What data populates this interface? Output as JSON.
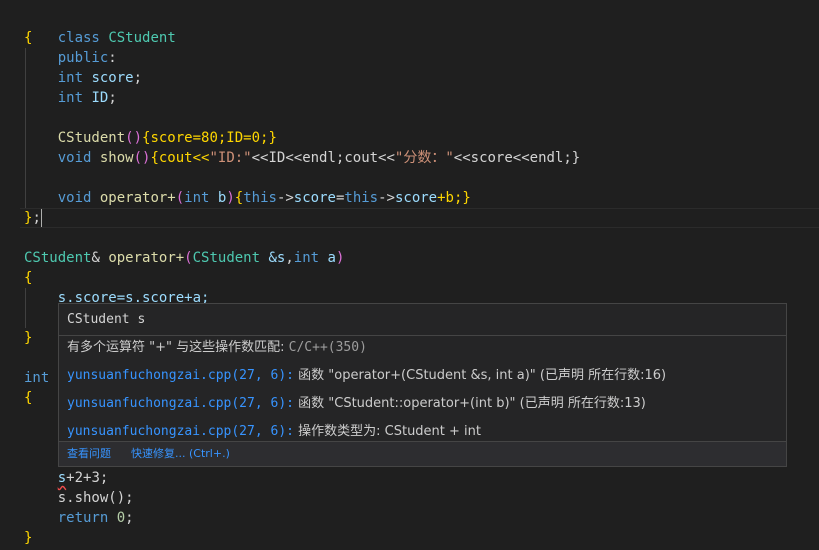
{
  "code": {
    "kw_class": "class",
    "cls_name": "CStudent",
    "lbrace": "{",
    "rbrace": "}",
    "semi": ";",
    "kw_public": "public",
    "colon": ":",
    "kw_int": "int",
    "var_score": "score",
    "var_id": "ID",
    "ctor_body": "{score=80;ID=0;}",
    "kw_void": "void",
    "fn_show": "show",
    "show_body_1": "{cout<<",
    "str_id": "\"ID:\"",
    "show_body_2": "<<ID<<endl;cout<<",
    "str_score": "\"分数：\"",
    "show_body_3": "<<score<<endl;}",
    "fn_operator": "operator+",
    "param_b": "b",
    "kw_this": "this",
    "arrow": "->",
    "member_body_3": "=",
    "member_body_end": "+b;}",
    "ret_type_amp": "&",
    "param_s": "&s",
    "param_a": "a",
    "comma": ",",
    "body_line": "s.score=s.score+a;",
    "stmt_expr_s": "s",
    "stmt_expr_rest": "+2+3;",
    "stmt_show": "s.show();",
    "kw_return": "return",
    "ret_val": "0",
    "lparen": "(",
    "rparen": ")",
    "parens": "()"
  },
  "hover": {
    "title": "CStudent s",
    "message": "有多个运算符 \"+\" 与这些操作数匹配:",
    "message_code": "C/C++(350)",
    "entries": [
      {
        "link": "yunsuanfuchongzai.cpp(27, 6):",
        "text": "函数 \"operator+(CStudent &s, int a)\" (已声明 所在行数:16)"
      },
      {
        "link": "yunsuanfuchongzai.cpp(27, 6):",
        "text": "函数 \"CStudent::operator+(int b)\" (已声明 所在行数:13)"
      },
      {
        "link": "yunsuanfuchongzai.cpp(27, 6):",
        "text": "操作数类型为: CStudent + int"
      }
    ],
    "action_view": "查看问题",
    "action_fix": "快速修复... (Ctrl+.)"
  },
  "colors": {
    "background": "#1f1f1f",
    "keyword": "#569cd6",
    "type": "#4ec9b0",
    "function": "#dcdcaa",
    "number": "#b5cea8",
    "string": "#ce9178",
    "link": "#3794ff",
    "error": "#f14c4c"
  }
}
